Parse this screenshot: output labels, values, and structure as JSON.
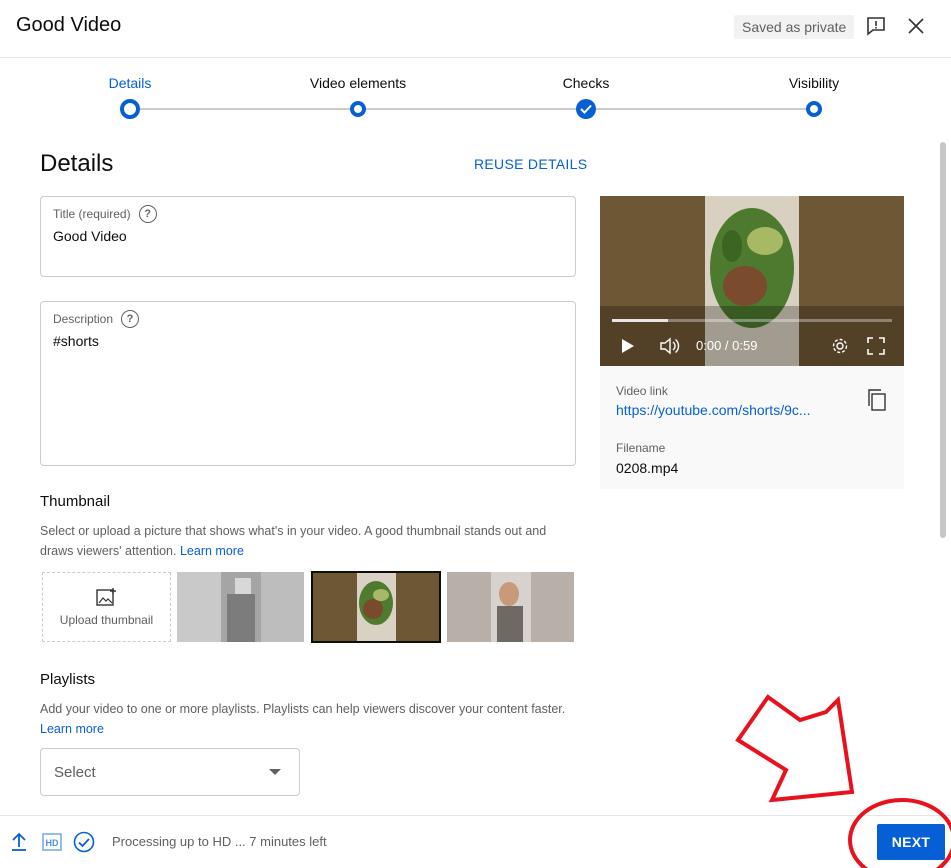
{
  "header": {
    "title": "Good Video",
    "saved_status": "Saved as private",
    "feedback_icon": "feedback-icon",
    "close_icon": "close-icon"
  },
  "stepper": {
    "steps": [
      {
        "label": "Details",
        "state": "active"
      },
      {
        "label": "Video elements",
        "state": "pending"
      },
      {
        "label": "Checks",
        "state": "done"
      },
      {
        "label": "Visibility",
        "state": "pending"
      }
    ]
  },
  "details": {
    "heading": "Details",
    "reuse_label": "REUSE DETAILS",
    "title_field": {
      "label": "Title (required)",
      "value": "Good Video"
    },
    "description_field": {
      "label": "Description",
      "value": "#shorts"
    },
    "help_glyph": "?"
  },
  "thumbnail": {
    "heading": "Thumbnail",
    "description": "Select or upload a picture that shows what's in your video. A good thumbnail stands out and draws viewers' attention.",
    "learn_more": "Learn more",
    "upload_label": "Upload thumbnail",
    "selected_index": 1
  },
  "playlists": {
    "heading": "Playlists",
    "description": "Add your video to one or more playlists. Playlists can help viewers discover your content faster.",
    "learn_more": "Learn more",
    "select_value": "Select"
  },
  "video_card": {
    "time": "0:00 / 0:59",
    "progress_fraction": 0.2,
    "video_link_label": "Video link",
    "video_link": "https://youtube.com/shorts/9c...",
    "filename_label": "Filename",
    "filename": "0208.mp4"
  },
  "footer": {
    "status": "Processing up to HD ... 7 minutes left",
    "hd_badge": "HD",
    "next_label": "NEXT"
  },
  "colors": {
    "accent": "#065fd4",
    "annotation": "#e8121e"
  }
}
